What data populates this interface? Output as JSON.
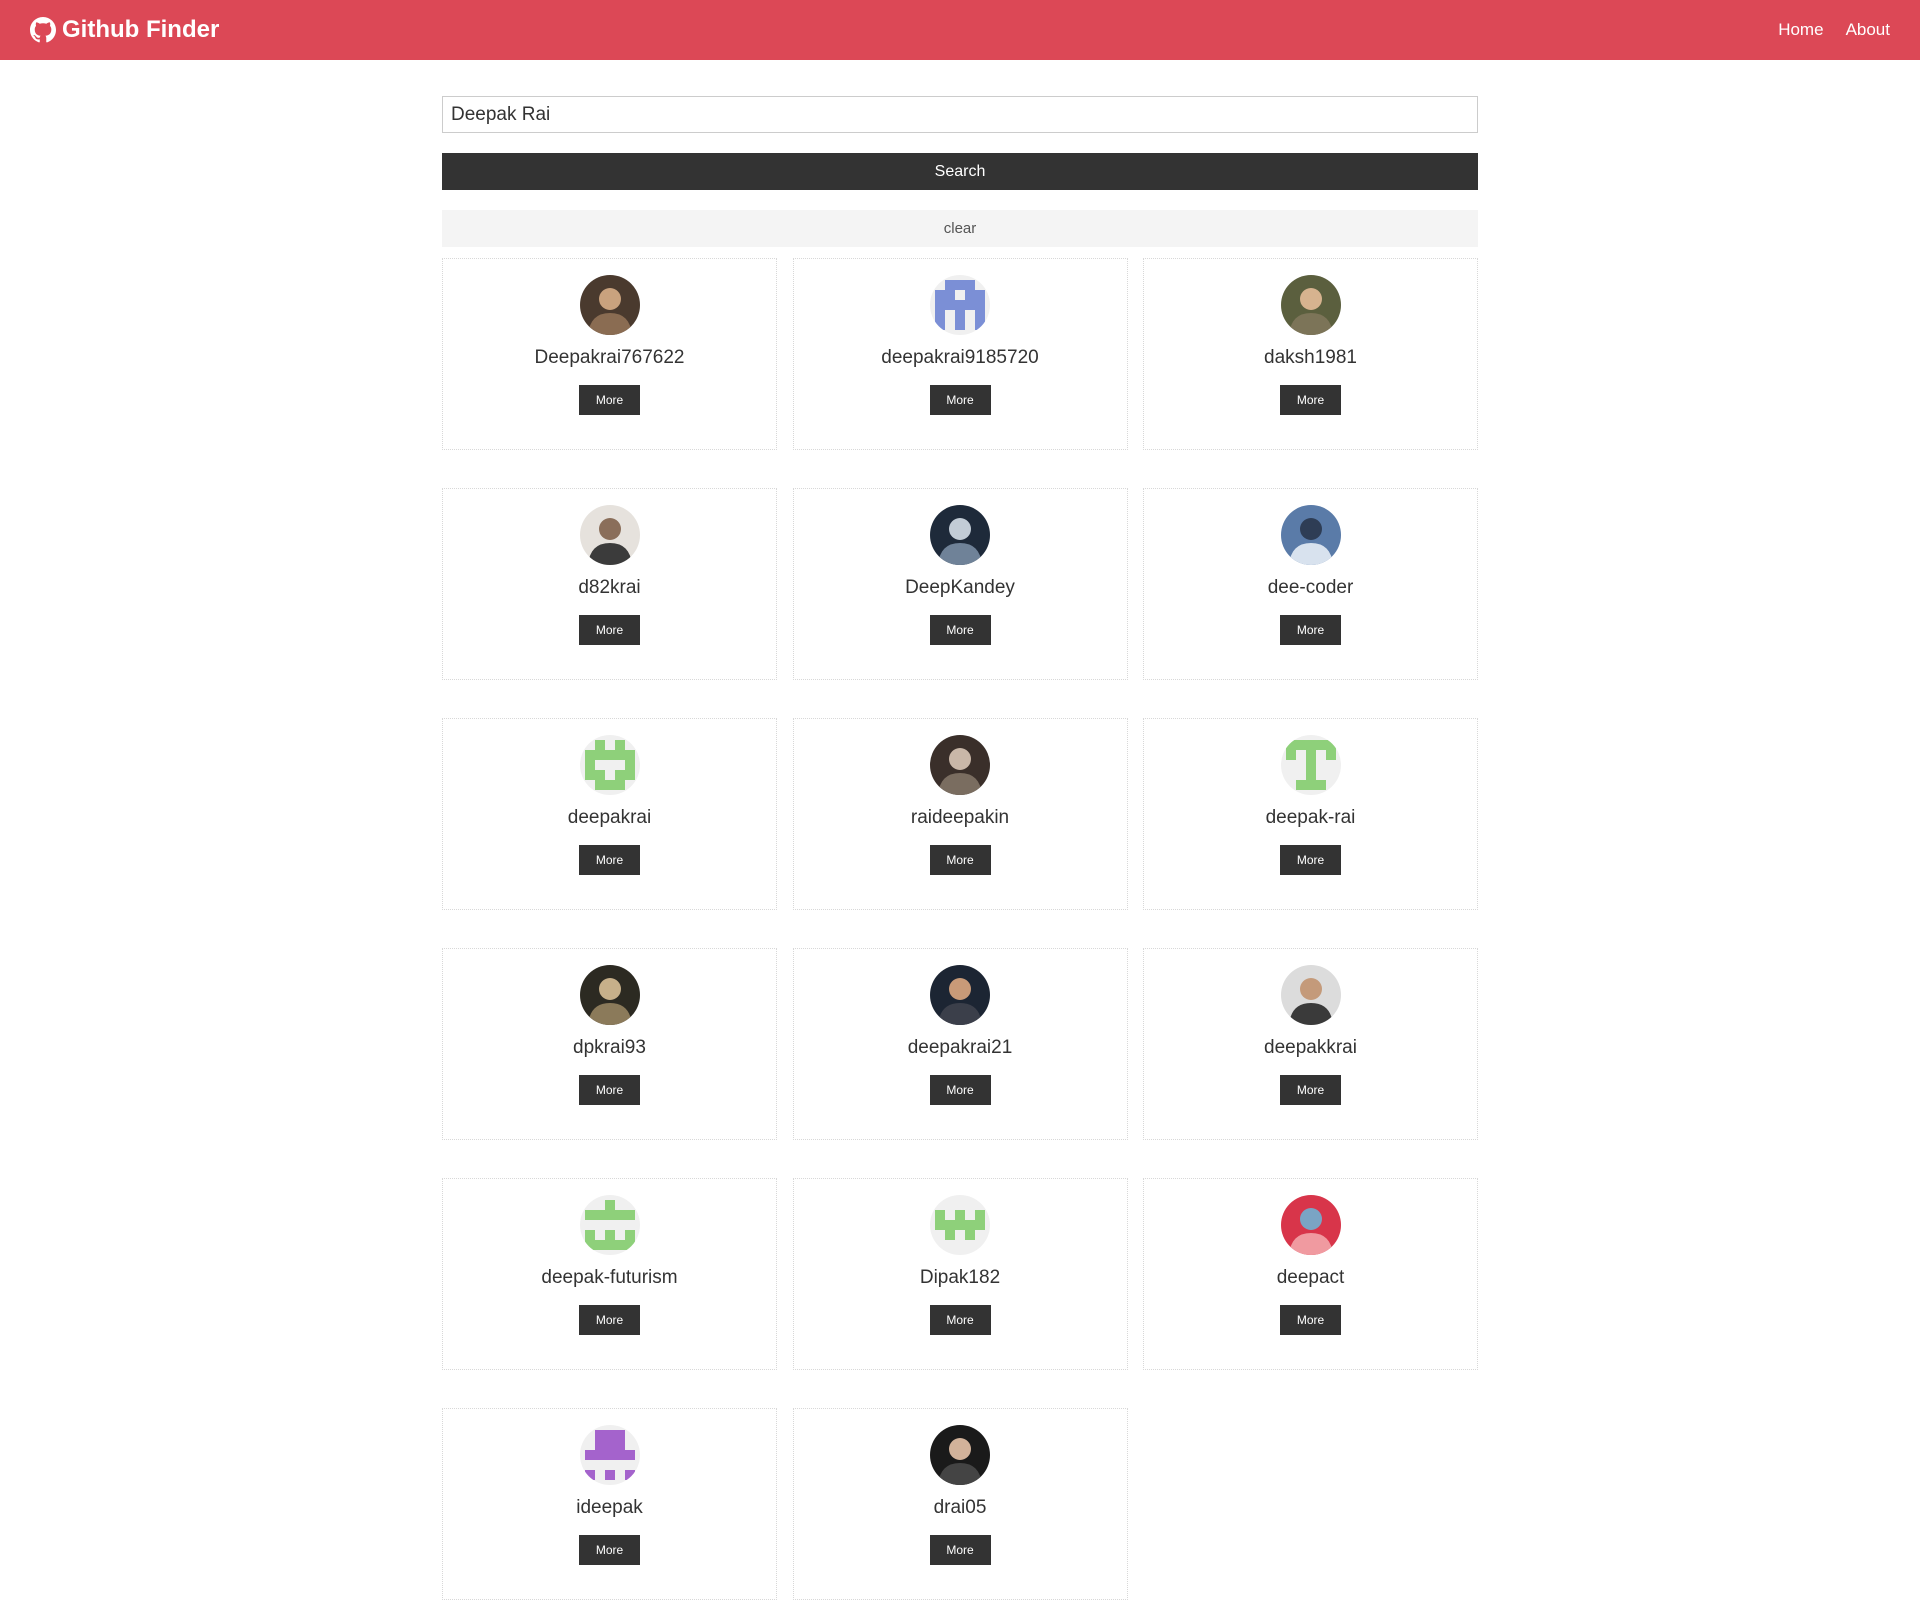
{
  "navbar": {
    "brand": "Github Finder",
    "links": [
      "Home",
      "About"
    ],
    "color": "#dc4856"
  },
  "search": {
    "value": "Deepak Rai",
    "button_label": "Search",
    "clear_label": "clear"
  },
  "users": [
    {
      "login": "Deepakrai767622",
      "avatar": "photo",
      "more": "More"
    },
    {
      "login": "deepakrai9185720",
      "avatar": "identicon-blue",
      "more": "More"
    },
    {
      "login": "daksh1981",
      "avatar": "photo",
      "more": "More"
    },
    {
      "login": "d82krai",
      "avatar": "photo",
      "more": "More"
    },
    {
      "login": "DeepKandey",
      "avatar": "photo",
      "more": "More"
    },
    {
      "login": "dee-coder",
      "avatar": "photo",
      "more": "More"
    },
    {
      "login": "deepakrai",
      "avatar": "identicon-green",
      "more": "More"
    },
    {
      "login": "raideepakin",
      "avatar": "photo",
      "more": "More"
    },
    {
      "login": "deepak-rai",
      "avatar": "identicon-green",
      "more": "More"
    },
    {
      "login": "dpkrai93",
      "avatar": "photo",
      "more": "More"
    },
    {
      "login": "deepakrai21",
      "avatar": "photo",
      "more": "More"
    },
    {
      "login": "deepakkrai",
      "avatar": "photo",
      "more": "More"
    },
    {
      "login": "deepak-futurism",
      "avatar": "identicon-green",
      "more": "More"
    },
    {
      "login": "Dipak182",
      "avatar": "identicon-green",
      "more": "More"
    },
    {
      "login": "deepact",
      "avatar": "photo",
      "more": "More"
    },
    {
      "login": "ideepak",
      "avatar": "identicon-purple",
      "more": "More"
    },
    {
      "login": "drai05",
      "avatar": "photo",
      "more": "More"
    }
  ]
}
